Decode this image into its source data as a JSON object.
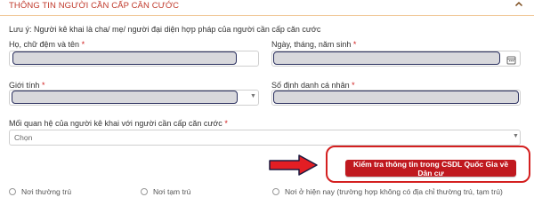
{
  "section": {
    "title": "THÔNG TIN NGƯỜI CẦN CẤP CĂN CƯỚC"
  },
  "note": "Lưu ý: Người kê khai là cha/ mẹ/ người đại diện hợp pháp của người cần cấp căn cước",
  "fields": {
    "full_name_label": "Họ, chữ đệm và tên",
    "dob_label": "Ngày, tháng, năm sinh",
    "gender_label": "Giới tính",
    "id_label": "Số định danh cá nhân",
    "relation_label": "Mối quan hệ của người kê khai với người cần cấp căn cước",
    "relation_placeholder": "Chọn",
    "required_mark": "*"
  },
  "check_button": "Kiểm tra thông tin trong CSDL Quốc Gia về Dân cư",
  "address_options": {
    "permanent": "Nơi thường trú",
    "temporary": "Nơi tạm trú",
    "current": "Nơi ở hiện nay (trường hợp không có địa chỉ thường trú, tạm trú)"
  },
  "colors": {
    "accent": "#c0191f",
    "highlight_border": "#2a2f5e",
    "annotation_red": "#d42020"
  },
  "icons": {
    "collapse": "chevron-up-icon",
    "calendar": "calendar-icon",
    "arrow": "arrow-right-icon"
  }
}
